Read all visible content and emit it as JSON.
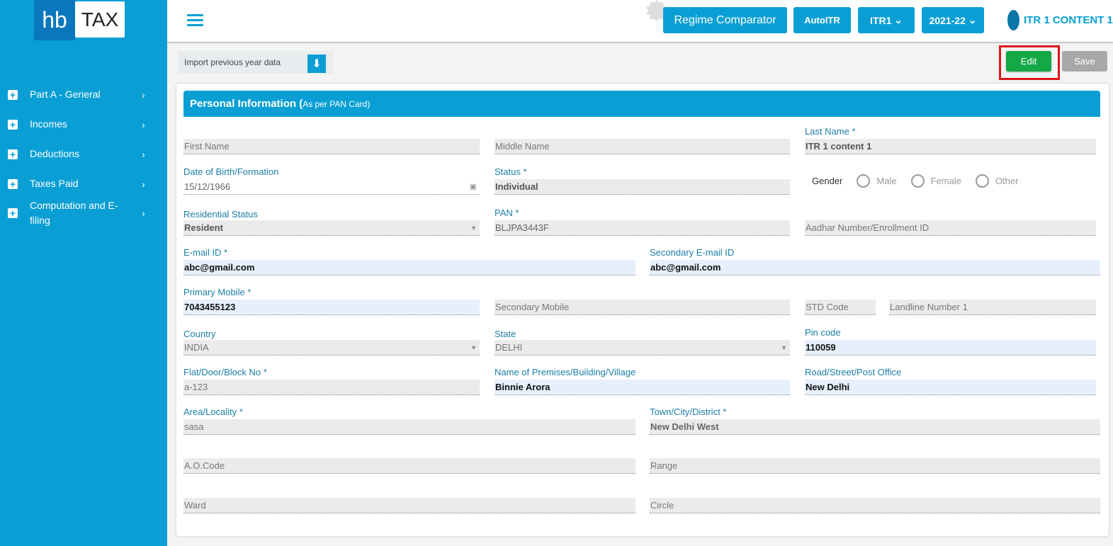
{
  "logo": {
    "part1": "hb",
    "part2": "TAX"
  },
  "sidebar": {
    "items": [
      {
        "label": "Part A - General"
      },
      {
        "label": "Incomes"
      },
      {
        "label": "Deductions"
      },
      {
        "label": "Taxes Paid"
      },
      {
        "label": "Computation and E-filing"
      }
    ]
  },
  "header": {
    "regime": "Regime Comparator",
    "autoitr": "AutoITR",
    "itr": "ITR1",
    "year": "2021-22",
    "user": "ITR 1 CONTENT 1"
  },
  "toolbar": {
    "import": "Import previous year data",
    "edit": "Edit",
    "save": "Save"
  },
  "section": {
    "title": "Personal Information (",
    "subtitle": "As per PAN Card)"
  },
  "gender": {
    "label": "Gender",
    "options": [
      "Male",
      "Female",
      "Other"
    ]
  },
  "fields": {
    "first_name": {
      "placeholder": "First Name"
    },
    "middle_name": {
      "placeholder": "Middle Name"
    },
    "last_name": {
      "label": "Last Name *",
      "value": "ITR 1 content 1"
    },
    "dob": {
      "label": "Date of Birth/Formation",
      "value": "15/12/1966"
    },
    "status": {
      "label": "Status *",
      "value": "Individual"
    },
    "residential": {
      "label": "Residential Status",
      "value": "Resident"
    },
    "pan": {
      "label": "PAN *",
      "value": "BLJPA3443F"
    },
    "aadhar": {
      "placeholder": "Aadhar Number/Enrollment ID"
    },
    "email": {
      "label": "E-mail ID *",
      "value": "abc@gmail.com"
    },
    "email2": {
      "label": "Secondary E-mail ID",
      "value": "abc@gmail.com"
    },
    "mobile": {
      "label": "Primary Mobile *",
      "value": "7043455123"
    },
    "mobile2": {
      "placeholder": "Secondary Mobile"
    },
    "std": {
      "placeholder": "STD Code"
    },
    "landline": {
      "placeholder": "Landline Number 1"
    },
    "country": {
      "label": "Country",
      "value": "INDIA"
    },
    "state": {
      "label": "State",
      "value": "DELHI"
    },
    "pin": {
      "label": "Pin code",
      "value": "110059"
    },
    "flat": {
      "label": "Flat/Door/Block No *",
      "value": "a-123"
    },
    "premises": {
      "label": "Name of Premises/Building/Village",
      "value": "Binnie Arora"
    },
    "road": {
      "label": "Road/Street/Post Office",
      "value": "New Delhi"
    },
    "area": {
      "label": "Area/Locality *",
      "value": "sasa"
    },
    "town": {
      "label": "Town/City/District *",
      "value": "New Delhi West"
    },
    "ao": {
      "placeholder": "A.O.Code"
    },
    "range": {
      "placeholder": "Range"
    },
    "ward": {
      "placeholder": "Ward"
    },
    "circle": {
      "placeholder": "Circle"
    }
  },
  "colors": {
    "primary": "#0a9fd4",
    "edit": "#14a847",
    "highlight": "#e0131a"
  }
}
